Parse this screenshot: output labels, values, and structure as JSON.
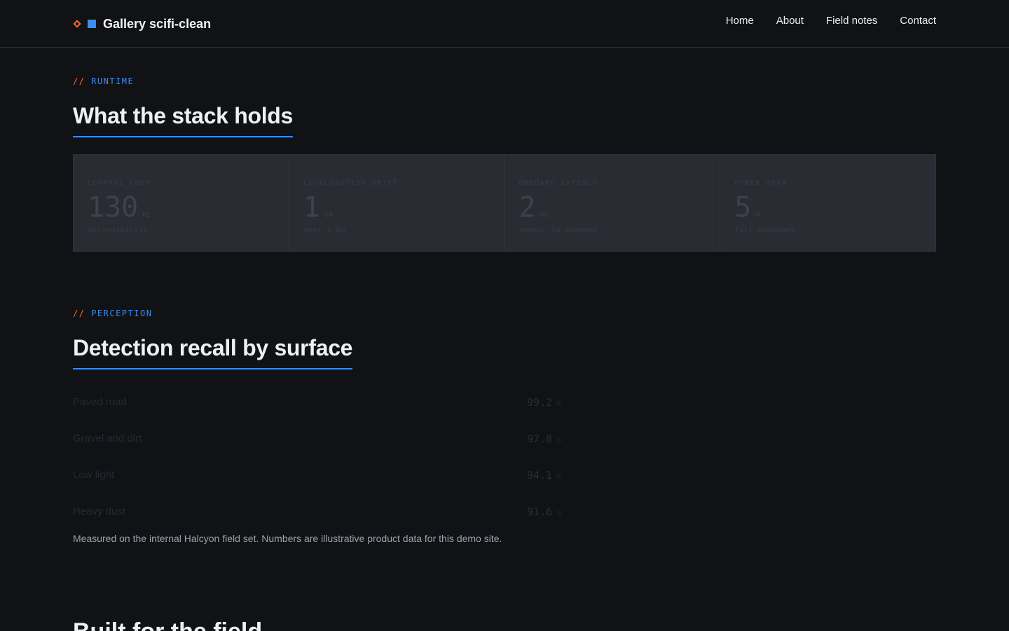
{
  "header": {
    "brand": "Gallery scifi-clean",
    "nav": [
      "Home",
      "About",
      "Field notes",
      "Contact"
    ]
  },
  "runtime": {
    "eyebrow_slashes": "//",
    "eyebrow_tag": "RUNTIME",
    "title": "What the stack holds",
    "stats": [
      {
        "label": "CONTROL LOOP",
        "value": "130",
        "unit": "Hz",
        "note": "deterministic"
      },
      {
        "label": "LOCALISATION DRIFT",
        "value": "1",
        "unit": "cm",
        "note": "over 1 km"
      },
      {
        "label": "ONBOARD LATENCY",
        "value": "2",
        "unit": "ms",
        "note": "sensor to command"
      },
      {
        "label": "POWER DRAW",
        "value": "5",
        "unit": "W",
        "note": "full autonomy"
      }
    ]
  },
  "perception": {
    "eyebrow_slashes": "//",
    "eyebrow_tag": "PERCEPTION",
    "title": "Detection recall by surface",
    "rows": [
      {
        "label": "Paved road",
        "value": "99.2",
        "unit": "%"
      },
      {
        "label": "Gravel and dirt",
        "value": "97.8",
        "unit": "%"
      },
      {
        "label": "Low light",
        "value": "94.1",
        "unit": "%"
      },
      {
        "label": "Heavy dust",
        "value": "91.6",
        "unit": "%"
      }
    ],
    "footnote": "Measured on the internal Halcyon field set. Numbers are illustrative product data for this demo site."
  },
  "next_section": {
    "title": "Built for the field"
  }
}
